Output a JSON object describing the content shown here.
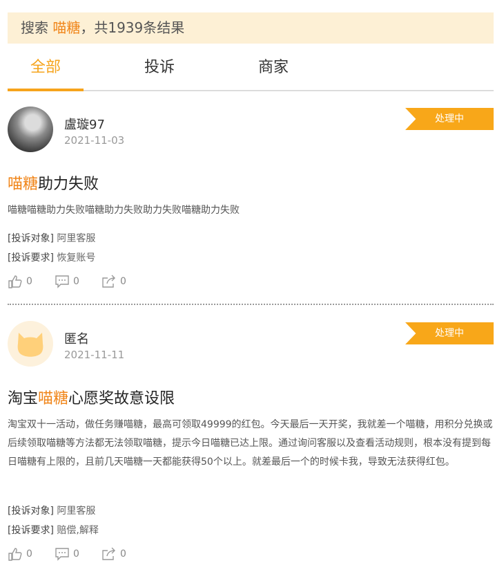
{
  "search": {
    "prefix": "搜索",
    "keyword": "喵糖",
    "suffix": "，共1939条结果"
  },
  "tabs": [
    {
      "label": "全部",
      "active": true
    },
    {
      "label": "投诉",
      "active": false
    },
    {
      "label": "商家",
      "active": false
    }
  ],
  "complaints": [
    {
      "username": "盧璇97",
      "date": "2021-11-03",
      "status": "处理中",
      "title_highlight": "喵糖",
      "title_rest": "助力失败",
      "description": "喵糖喵糖助力失败喵糖助力失败助力失败喵糖助力失败",
      "target_label": "[投诉对象]",
      "target_value": "阿里客服",
      "request_label": "[投诉要求]",
      "request_value": "恢复账号",
      "likes": "0",
      "comments": "0",
      "shares": "0"
    },
    {
      "username": "匿名",
      "date": "2021-11-11",
      "status": "处理中",
      "title_prefix": "淘宝",
      "title_highlight": "喵糖",
      "title_rest": "心愿奖故意设限",
      "description": "淘宝双十一活动，做任务赚喵糖，最高可领取49999的红包。今天最后一天开奖，我就差一个喵糖，用积分兑换或后续领取喵糖等方法都无法领取喵糖，提示今日喵糖已达上限。通过询问客服以及查看活动规则，根本没有提到每日喵糖有上限的，且前几天喵糖一天都能获得50个以上。就差最后一个的时候卡我，导致无法获得红包。",
      "target_label": "[投诉对象]",
      "target_value": "阿里客服",
      "request_label": "[投诉要求]",
      "request_value": "赔偿,解释",
      "likes": "0",
      "comments": "0",
      "shares": "0"
    }
  ],
  "colors": {
    "accent": "#f6a41c",
    "highlight": "#f08519",
    "search_bg": "#fdf0d5",
    "badge": "#f8a719"
  },
  "icons": [
    "thumbs-up-icon",
    "comment-icon",
    "share-icon"
  ]
}
